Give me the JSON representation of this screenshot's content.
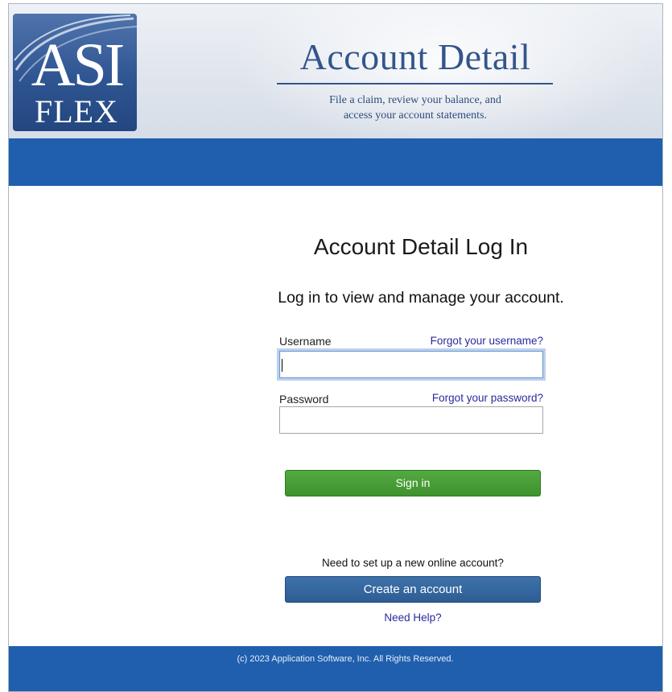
{
  "header": {
    "logo_line1": "ASI",
    "logo_line2": "FLEX",
    "title": "Account Detail",
    "subtitle_line1": "File a claim, review your balance, and",
    "subtitle_line2": "access your account statements."
  },
  "login": {
    "title": "Account Detail Log In",
    "subtitle": "Log in to view and manage your account.",
    "username_label": "Username",
    "forgot_username": "Forgot your username?",
    "username_value": "",
    "password_label": "Password",
    "forgot_password": "Forgot your password?",
    "password_value": "",
    "sign_in": "Sign in"
  },
  "signup": {
    "prompt": "Need to set up a new online account?",
    "create_button": "Create an account",
    "help_link": "Need Help?"
  },
  "footer": {
    "copyright": "(c) 2023 Application Software, Inc.  All Rights Reserved."
  },
  "colors": {
    "brand_blue": "#1f5fae",
    "header_text": "#33558b",
    "sign_in_green": "#4a9e38",
    "create_blue": "#2d5d95",
    "link": "#2a2aa0"
  }
}
